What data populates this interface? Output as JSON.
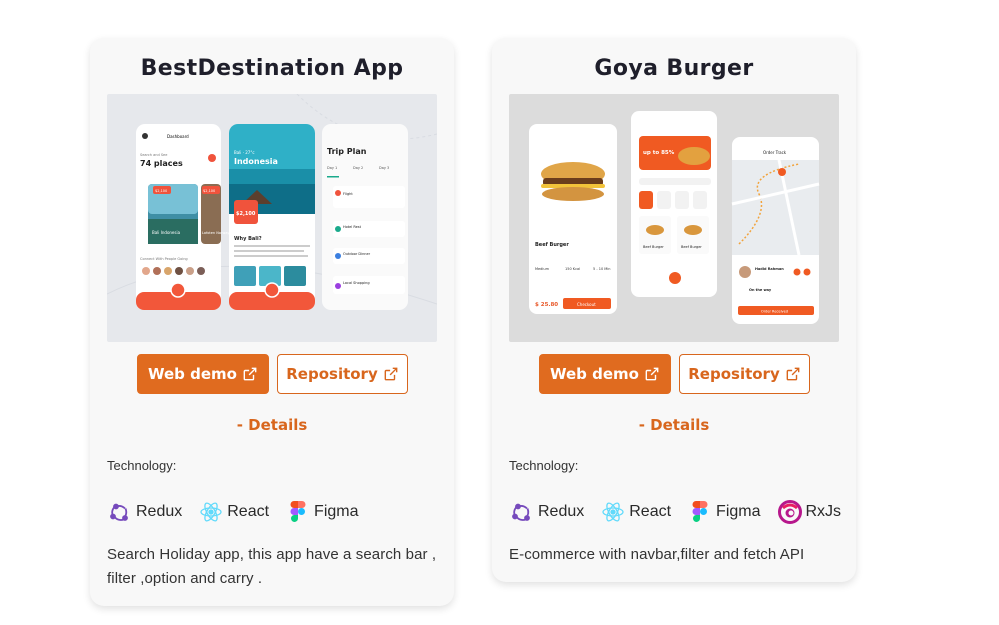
{
  "projects": [
    {
      "title": "BestDestination App",
      "web_demo_label": "Web demo",
      "repository_label": "Repository",
      "details_label": "- Details",
      "technology_label": "Technology:",
      "technologies": [
        {
          "name": "Redux",
          "icon": "redux-icon"
        },
        {
          "name": "React",
          "icon": "react-icon"
        },
        {
          "name": "Figma",
          "icon": "figma-icon"
        }
      ],
      "description": "Search Holiday app, this app have a search bar , filter ,option and carry .",
      "screenshot": {
        "phone1": {
          "header": "Dashboard",
          "subtitle": "Search and See",
          "count": "74 places",
          "price1": "$2,100",
          "price2": "$2,100",
          "card1": "Bali Indonesia",
          "card2": "Lofoten Norway",
          "footer": "Connect With People Going"
        },
        "phone2": {
          "top": "Bali · 27°c",
          "title": "Indonesia",
          "price": "$2,100",
          "question": "Why Bali?"
        },
        "phone3": {
          "title": "Trip Plan",
          "days": [
            "Day 1",
            "Day 2",
            "Day 3"
          ],
          "items": [
            "Flight",
            "Hotel Rest",
            "Outdoor Dinner",
            "Local Shopping"
          ]
        }
      }
    },
    {
      "title": "Goya Burger",
      "web_demo_label": "Web demo",
      "repository_label": "Repository",
      "details_label": "- Details",
      "technology_label": "Technology:",
      "technologies": [
        {
          "name": "Redux",
          "icon": "redux-icon"
        },
        {
          "name": "React",
          "icon": "react-icon"
        },
        {
          "name": "Figma",
          "icon": "figma-icon"
        },
        {
          "name": "RxJs",
          "icon": "rxjs-icon"
        }
      ],
      "description": "E-commerce with navbar,filter and fetch API",
      "screenshot": {
        "phone1": {
          "name": "Beef Burger",
          "specs": [
            "Medium",
            "150 Kcal",
            "5 - 10 Min"
          ],
          "price": "$ 25.80",
          "checkout": "Checkout"
        },
        "phone2": {
          "promo": "up to 85%",
          "items": [
            "Beef Burger",
            "Beef Burger"
          ]
        },
        "phone3": {
          "title": "Order Track",
          "courier": "Hadid Rahman",
          "status": "On the way",
          "button": "Order Received"
        }
      }
    }
  ],
  "colors": {
    "accent": "#e06b1f",
    "accent_text": "#d8661d",
    "card_bg": "#f8f8f8",
    "title": "#1f1f2b"
  }
}
